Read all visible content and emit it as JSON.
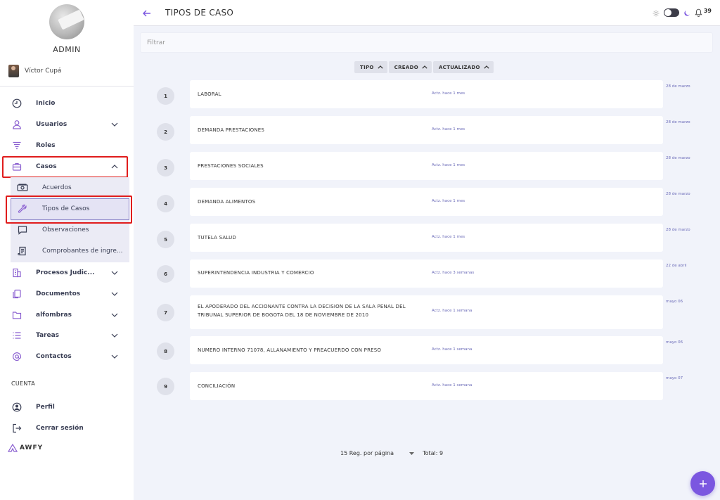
{
  "sidebar": {
    "role": "ADMIN",
    "user_name": "Víctor Cupá",
    "items": [
      {
        "label": "Inicio",
        "icon": "clock-icon"
      },
      {
        "label": "Usuarios",
        "icon": "user-icon"
      },
      {
        "label": "Roles",
        "icon": "roles-icon"
      },
      {
        "label": "Casos",
        "icon": "briefcase-icon"
      },
      {
        "label": "Procesos Judic...",
        "icon": "building-icon"
      },
      {
        "label": "Documentos",
        "icon": "documents-icon"
      },
      {
        "label": "alfombras",
        "icon": "folder-icon"
      },
      {
        "label": "Tareas",
        "icon": "list-icon"
      },
      {
        "label": "Contactos",
        "icon": "at-icon"
      }
    ],
    "sub_items": [
      {
        "label": "Acuerdos",
        "icon": "money-icon"
      },
      {
        "label": "Tipos de Casos",
        "icon": "wrench-icon"
      },
      {
        "label": "Observaciones",
        "icon": "comment-icon"
      },
      {
        "label": "Comprobantes de ingre...",
        "icon": "receipt-icon"
      }
    ],
    "section_label": "CUENTA",
    "account_items": [
      {
        "label": "Perfil",
        "icon": "profile-icon"
      },
      {
        "label": "Cerrar sesión",
        "icon": "logout-icon"
      }
    ],
    "logo_text": "AWFY"
  },
  "header": {
    "title": "TIPOS DE CASO",
    "notification_count": "39"
  },
  "filter": {
    "placeholder": "Filtrar"
  },
  "sort_buttons": [
    "TIPO",
    "CREADO",
    "ACTUALIZADO"
  ],
  "rows": [
    {
      "num": "1",
      "name": "LABORAL",
      "updated": "Actz. hace 1 mes",
      "date": "28 de marzo"
    },
    {
      "num": "2",
      "name": "DEMANDA PRESTACIONES",
      "updated": "Actz. hace 1 mes",
      "date": "28 de marzo"
    },
    {
      "num": "3",
      "name": "PRESTACIONES SOCIALES",
      "updated": "Actz. hace 1 mes",
      "date": "28 de marzo"
    },
    {
      "num": "4",
      "name": "DEMANDA ALIMENTOS",
      "updated": "Actz. hace 1 mes",
      "date": "28 de marzo"
    },
    {
      "num": "5",
      "name": "TUTELA SALUD",
      "updated": "Actz. hace 1 mes",
      "date": "28 de marzo"
    },
    {
      "num": "6",
      "name": "SUPERINTENDENCIA INDUSTRIA Y COMERCIO",
      "updated": "Actz. hace 3 semanas",
      "date": "22 de abril"
    },
    {
      "num": "7",
      "name": "EL APODERADO DEL ACCIONANTE CONTRA LA DECISION DE LA SALA PENAL DEL TRIBUNAL SUPERIOR DE BOGOTA DEL 18 DE NOVIEMBRE DE 2010",
      "updated": "Actz. hace 1 semana",
      "date": "mayo 06"
    },
    {
      "num": "8",
      "name": "NUMERO INTERNO 71078, ALLANAMIENTO Y PREACUERDO CON PRESO",
      "updated": "Actz. hace 1 semana",
      "date": "mayo 06"
    },
    {
      "num": "9",
      "name": "CONCILIACIÓN",
      "updated": "Actz. hace 1 semana",
      "date": "mayo 07"
    }
  ],
  "pagination": {
    "per_page": "15 Reg. por página",
    "total": "Total: 9"
  },
  "colors": {
    "accent": "#7b57e0",
    "highlight": "#e01c1c",
    "link": "#6b6bb8"
  }
}
